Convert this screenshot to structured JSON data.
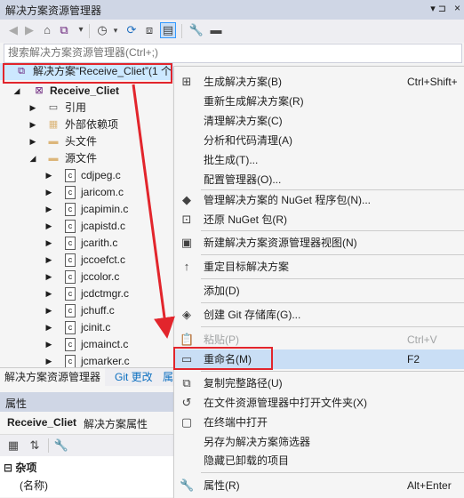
{
  "window": {
    "title": "解决方案资源管理器",
    "pin_glyph": "▾ ⊐",
    "close_glyph": "×"
  },
  "toolbar": {
    "icons": [
      "back-icon",
      "forward-icon",
      "home-icon",
      "vs-icon",
      "switch-views-icon",
      "history-icon",
      "sync-icon",
      "collapse-all-icon",
      "show-all-files-icon",
      "properties-icon",
      "preview-icon"
    ]
  },
  "search": {
    "placeholder": "搜索解决方案资源管理器(Ctrl+;)"
  },
  "tree": {
    "solution_label": "解决方案“Receive_Cliet”(1 个",
    "project_label": "Receive_Cliet",
    "references": "引用",
    "external_deps": "外部依赖项",
    "header_files": "头文件",
    "source_files": "源文件",
    "files": [
      "cdjpeg.c",
      "jaricom.c",
      "jcapimin.c",
      "jcapistd.c",
      "jcarith.c",
      "jccoefct.c",
      "jccolor.c",
      "jcdctmgr.c",
      "jchuff.c",
      "jcinit.c",
      "jcmainct.c",
      "jcmarker.c"
    ]
  },
  "tabs": {
    "solution_explorer": "解决方案资源管理器",
    "git_changes": "Git 更改",
    "third": "属"
  },
  "properties": {
    "header": "属性",
    "object_name": "Receive_Cliet",
    "object_type": "解决方案属性",
    "category": "杂项",
    "first_prop": "(名称)",
    "category_glyph": "⊟"
  },
  "menu": {
    "items": [
      {
        "label": "生成解决方案(B)",
        "shortcut": "Ctrl+Shift+",
        "icon": "build-icon"
      },
      {
        "label": "重新生成解决方案(R)",
        "shortcut": "",
        "icon": ""
      },
      {
        "label": "清理解决方案(C)",
        "shortcut": "",
        "icon": ""
      },
      {
        "label": "分析和代码清理(A)",
        "shortcut": "",
        "icon": ""
      },
      {
        "label": "批生成(T)...",
        "shortcut": "",
        "icon": ""
      },
      {
        "label": "配置管理器(O)...",
        "shortcut": "",
        "icon": ""
      },
      {
        "label": "管理解决方案的 NuGet 程序包(N)...",
        "shortcut": "",
        "icon": "nuget-icon"
      },
      {
        "label": "还原 NuGet 包(R)",
        "shortcut": "",
        "icon": "restore-icon"
      },
      {
        "label": "新建解决方案资源管理器视图(N)",
        "shortcut": "",
        "icon": "new-view-icon"
      },
      {
        "label": "重定目标解决方案",
        "shortcut": "",
        "icon": "retarget-icon"
      },
      {
        "label": "添加(D)",
        "shortcut": "",
        "icon": ""
      },
      {
        "label": "创建 Git 存储库(G)...",
        "shortcut": "",
        "icon": "git-icon"
      },
      {
        "label": "粘贴(P)",
        "shortcut": "Ctrl+V",
        "icon": "paste-icon",
        "disabled": true
      },
      {
        "label": "重命名(M)",
        "shortcut": "F2",
        "icon": "rename-icon",
        "highlighted": true
      },
      {
        "label": "复制完整路径(U)",
        "shortcut": "",
        "icon": "copy-icon"
      },
      {
        "label": "在文件资源管理器中打开文件夹(X)",
        "shortcut": "",
        "icon": "open-folder-icon"
      },
      {
        "label": "在终端中打开",
        "shortcut": "",
        "icon": "terminal-icon"
      },
      {
        "label": "另存为解决方案筛选器",
        "shortcut": "",
        "icon": ""
      },
      {
        "label": "隐藏已卸载的项目",
        "shortcut": "",
        "icon": ""
      },
      {
        "label": "属性(R)",
        "shortcut": "Alt+Enter",
        "icon": "wrench-icon"
      }
    ]
  },
  "colors": {
    "annotation_red": "#e2252c",
    "selection_blue": "#cce8ff",
    "menu_highlight": "#c9def5"
  }
}
